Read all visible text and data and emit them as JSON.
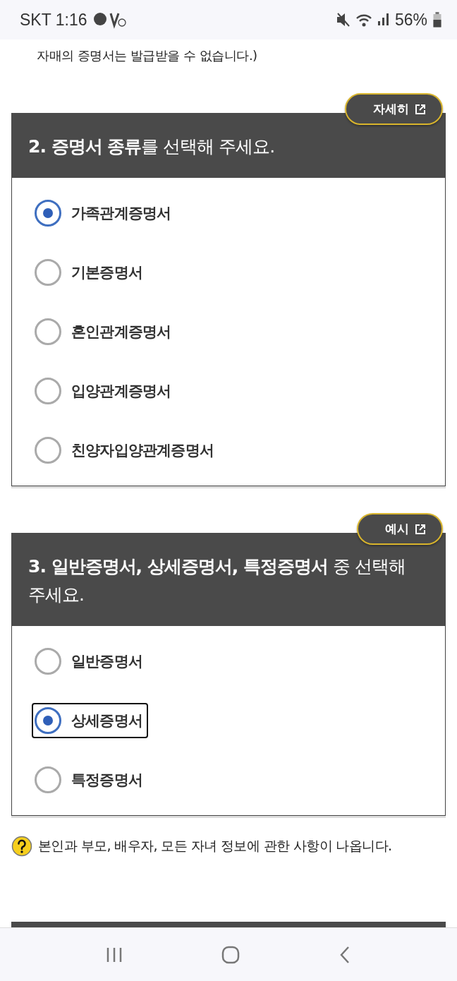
{
  "status_bar": {
    "carrier_time": "SKT 1:16",
    "battery": "56%"
  },
  "top_note": {
    "text": "자매의 증명서는 발급받을 수 없습니다.)"
  },
  "sections": [
    {
      "link": "자세히",
      "heading": "**2. 증명서 종류**를 선택해 주세요.",
      "options": [
        {
          "label": "가족관계증명서",
          "selected": true,
          "focused": false
        },
        {
          "label": "기본증명서",
          "selected": false,
          "focused": false
        },
        {
          "label": "혼인관계증명서",
          "selected": false,
          "focused": false
        },
        {
          "label": "입양관계증명서",
          "selected": false,
          "focused": false
        },
        {
          "label": "친양자입양관계증명서",
          "selected": false,
          "focused": false
        }
      ]
    },
    {
      "link": "예시",
      "heading": "**3. 일반증명서, 상세증명서, 특정증명서** 중 선택해 주세요.",
      "options": [
        {
          "label": "일반증명서",
          "selected": false,
          "focused": false
        },
        {
          "label": "상세증명서",
          "selected": true,
          "focused": true
        },
        {
          "label": "특정증명서",
          "selected": false,
          "focused": false
        }
      ],
      "note": "본인과 부모, 배우자, 모든 자녀 정보에 관한 사항이 나옵니다."
    }
  ]
}
